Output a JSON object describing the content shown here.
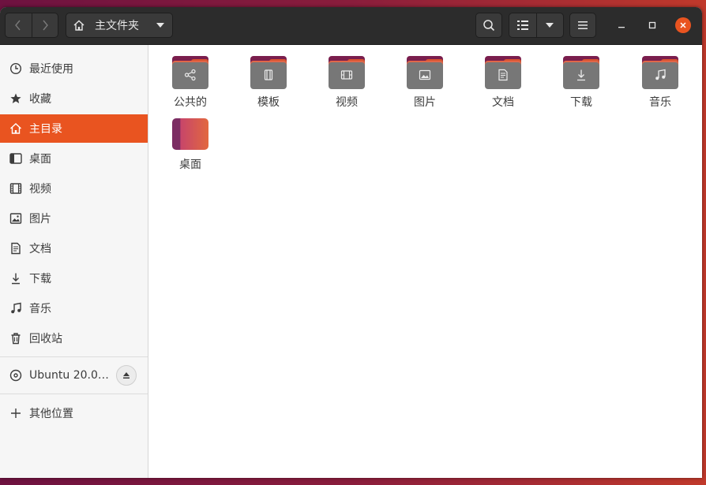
{
  "window": {
    "path_label": "主文件夹"
  },
  "sidebar": {
    "items": [
      {
        "label": "最近使用",
        "icon": "clock-icon"
      },
      {
        "label": "收藏",
        "icon": "star-icon"
      },
      {
        "label": "主目录",
        "icon": "home-icon",
        "active": true
      },
      {
        "label": "桌面",
        "icon": "desktop-icon"
      },
      {
        "label": "视频",
        "icon": "film-icon"
      },
      {
        "label": "图片",
        "icon": "image-icon"
      },
      {
        "label": "文档",
        "icon": "document-icon"
      },
      {
        "label": "下载",
        "icon": "download-icon"
      },
      {
        "label": "音乐",
        "icon": "music-icon"
      },
      {
        "label": "回收站",
        "icon": "trash-icon"
      }
    ],
    "device": {
      "label": "Ubuntu 20.0…",
      "icon": "disc-icon"
    },
    "other_locations": {
      "label": "其他位置",
      "icon": "plus-icon"
    }
  },
  "files": [
    {
      "name": "公共的",
      "icon": "share-icon"
    },
    {
      "name": "模板",
      "icon": "template-icon"
    },
    {
      "name": "视频",
      "icon": "film-icon"
    },
    {
      "name": "图片",
      "icon": "image-icon"
    },
    {
      "name": "文档",
      "icon": "document-icon"
    },
    {
      "name": "下载",
      "icon": "download-icon"
    },
    {
      "name": "音乐",
      "icon": "music-icon"
    },
    {
      "name": "桌面",
      "icon": "desktop-folder-icon"
    }
  ],
  "colors": {
    "accent": "#e95420",
    "headerbar": "#2c2c2c",
    "sidebar_bg": "#f6f6f6",
    "folder_body": "#777777",
    "folder_tab": "#7a1e4d"
  }
}
